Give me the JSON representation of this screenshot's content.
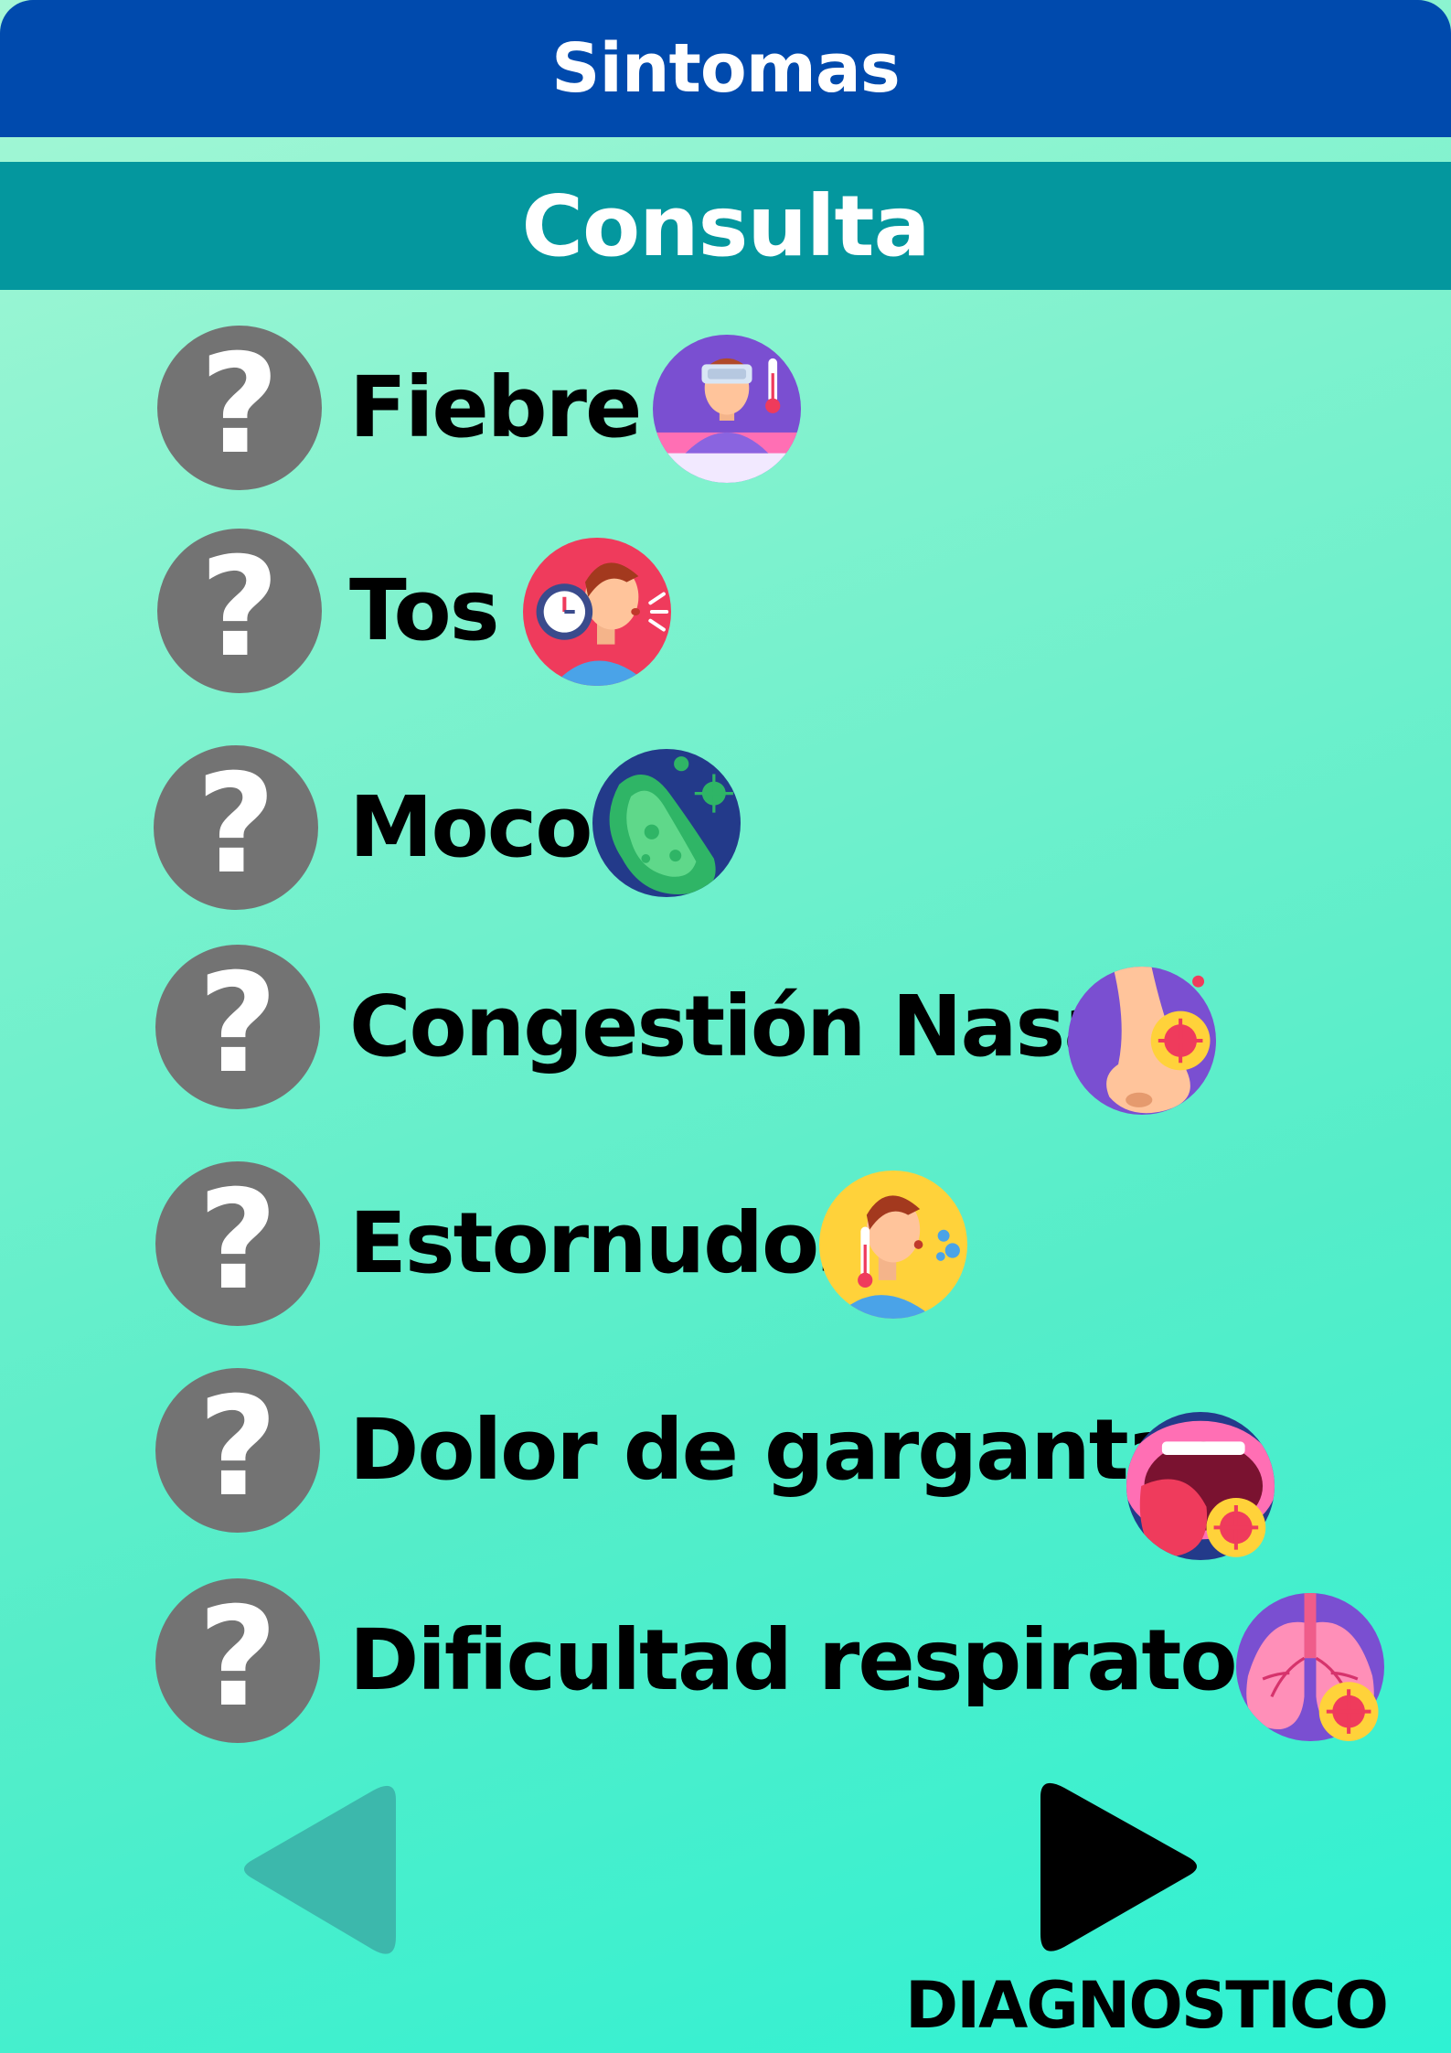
{
  "header": {
    "title": "Sintomas"
  },
  "subheader": {
    "title": "Consulta"
  },
  "symptoms": [
    {
      "label": "Fiebre",
      "button": "?",
      "icon": "fever-icon"
    },
    {
      "label": "Tos",
      "button": "?",
      "icon": "cough-icon"
    },
    {
      "label": "Moco",
      "button": "?",
      "icon": "mucus-icon"
    },
    {
      "label": "Congestión Nasal",
      "button": "?",
      "icon": "nasal-congestion-icon"
    },
    {
      "label": "Estornudos",
      "button": "?",
      "icon": "sneeze-icon"
    },
    {
      "label": "Dolor de garganta",
      "button": "?",
      "icon": "sore-throat-icon"
    },
    {
      "label": "Dificultad respiratoria",
      "button": "?",
      "icon": "lungs-icon"
    }
  ],
  "nav": {
    "next_label": "DIAGNOSTICO",
    "back_icon": "triangle-left-icon",
    "next_icon": "triangle-right-icon"
  },
  "colors": {
    "header": "#004aad",
    "subheader": "#04979e",
    "question_button": "#737373",
    "back_button": "#3cb8ac",
    "next_button": "#000000",
    "background_start": "#a6f7d6",
    "background_end": "#2ef2d3"
  }
}
